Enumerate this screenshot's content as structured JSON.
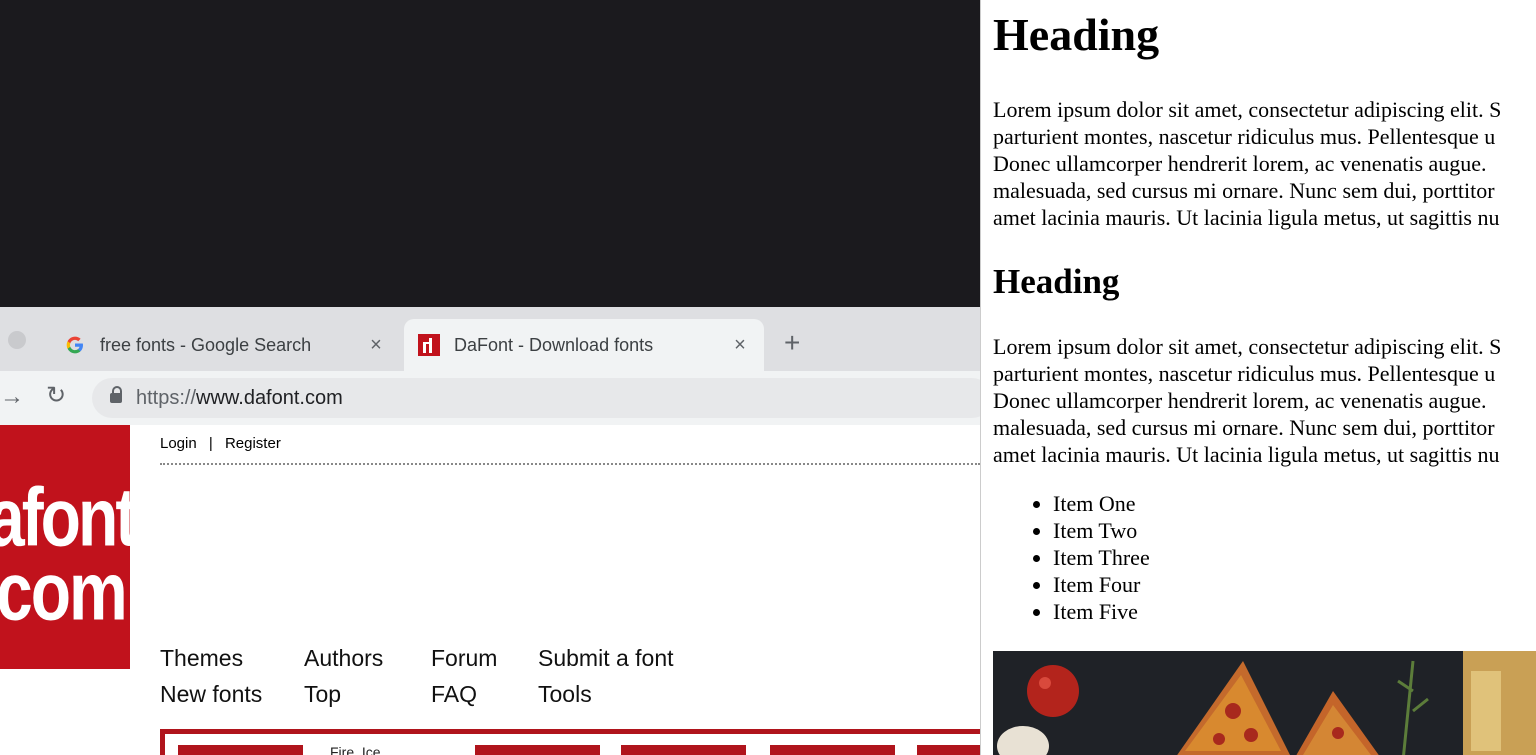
{
  "browser": {
    "tabs": [
      {
        "title": "free fonts - Google Search",
        "close": "×"
      },
      {
        "title": "DaFont - Download fonts",
        "close": "×"
      }
    ],
    "new_tab": "+",
    "url_scheme": "https://",
    "url_host": "www.dafont.com"
  },
  "dafont": {
    "logo_line1": "afont",
    "logo_line2": "com",
    "login": "Login",
    "separator": "|",
    "register": "Register",
    "menu": [
      [
        "Themes",
        "Authors",
        "Forum",
        "Submit a font"
      ],
      [
        "New fonts",
        "Top",
        "FAQ",
        "Tools"
      ]
    ],
    "subbar_text": "Fire, Ice"
  },
  "preview": {
    "heading1": "Heading",
    "heading2": "Heading",
    "paragraph_lines": [
      "Lorem ipsum dolor sit amet, consectetur adipiscing elit. S",
      "parturient montes, nascetur ridiculus mus. Pellentesque u",
      "Donec ullamcorper hendrerit lorem, ac venenatis augue.",
      "malesuada, sed cursus mi ornare. Nunc sem dui, porttitor",
      "amet lacinia mauris. Ut lacinia ligula metus, ut sagittis nu"
    ],
    "list_items": [
      "Item One",
      "Item Two",
      "Item Three",
      "Item Four",
      "Item Five"
    ]
  },
  "colors": {
    "dafont_red": "#c1121c",
    "google_blue": "#4285f4",
    "google_red": "#ea4335",
    "google_yellow": "#fbbc05",
    "google_green": "#34a853"
  },
  "icons": {
    "google_favicon": "google-g-icon",
    "dafont_favicon": "dafont-favicon-icon",
    "close": "close-icon",
    "forward": "forward-arrow-icon",
    "reload": "reload-icon",
    "lock": "lock-icon"
  }
}
